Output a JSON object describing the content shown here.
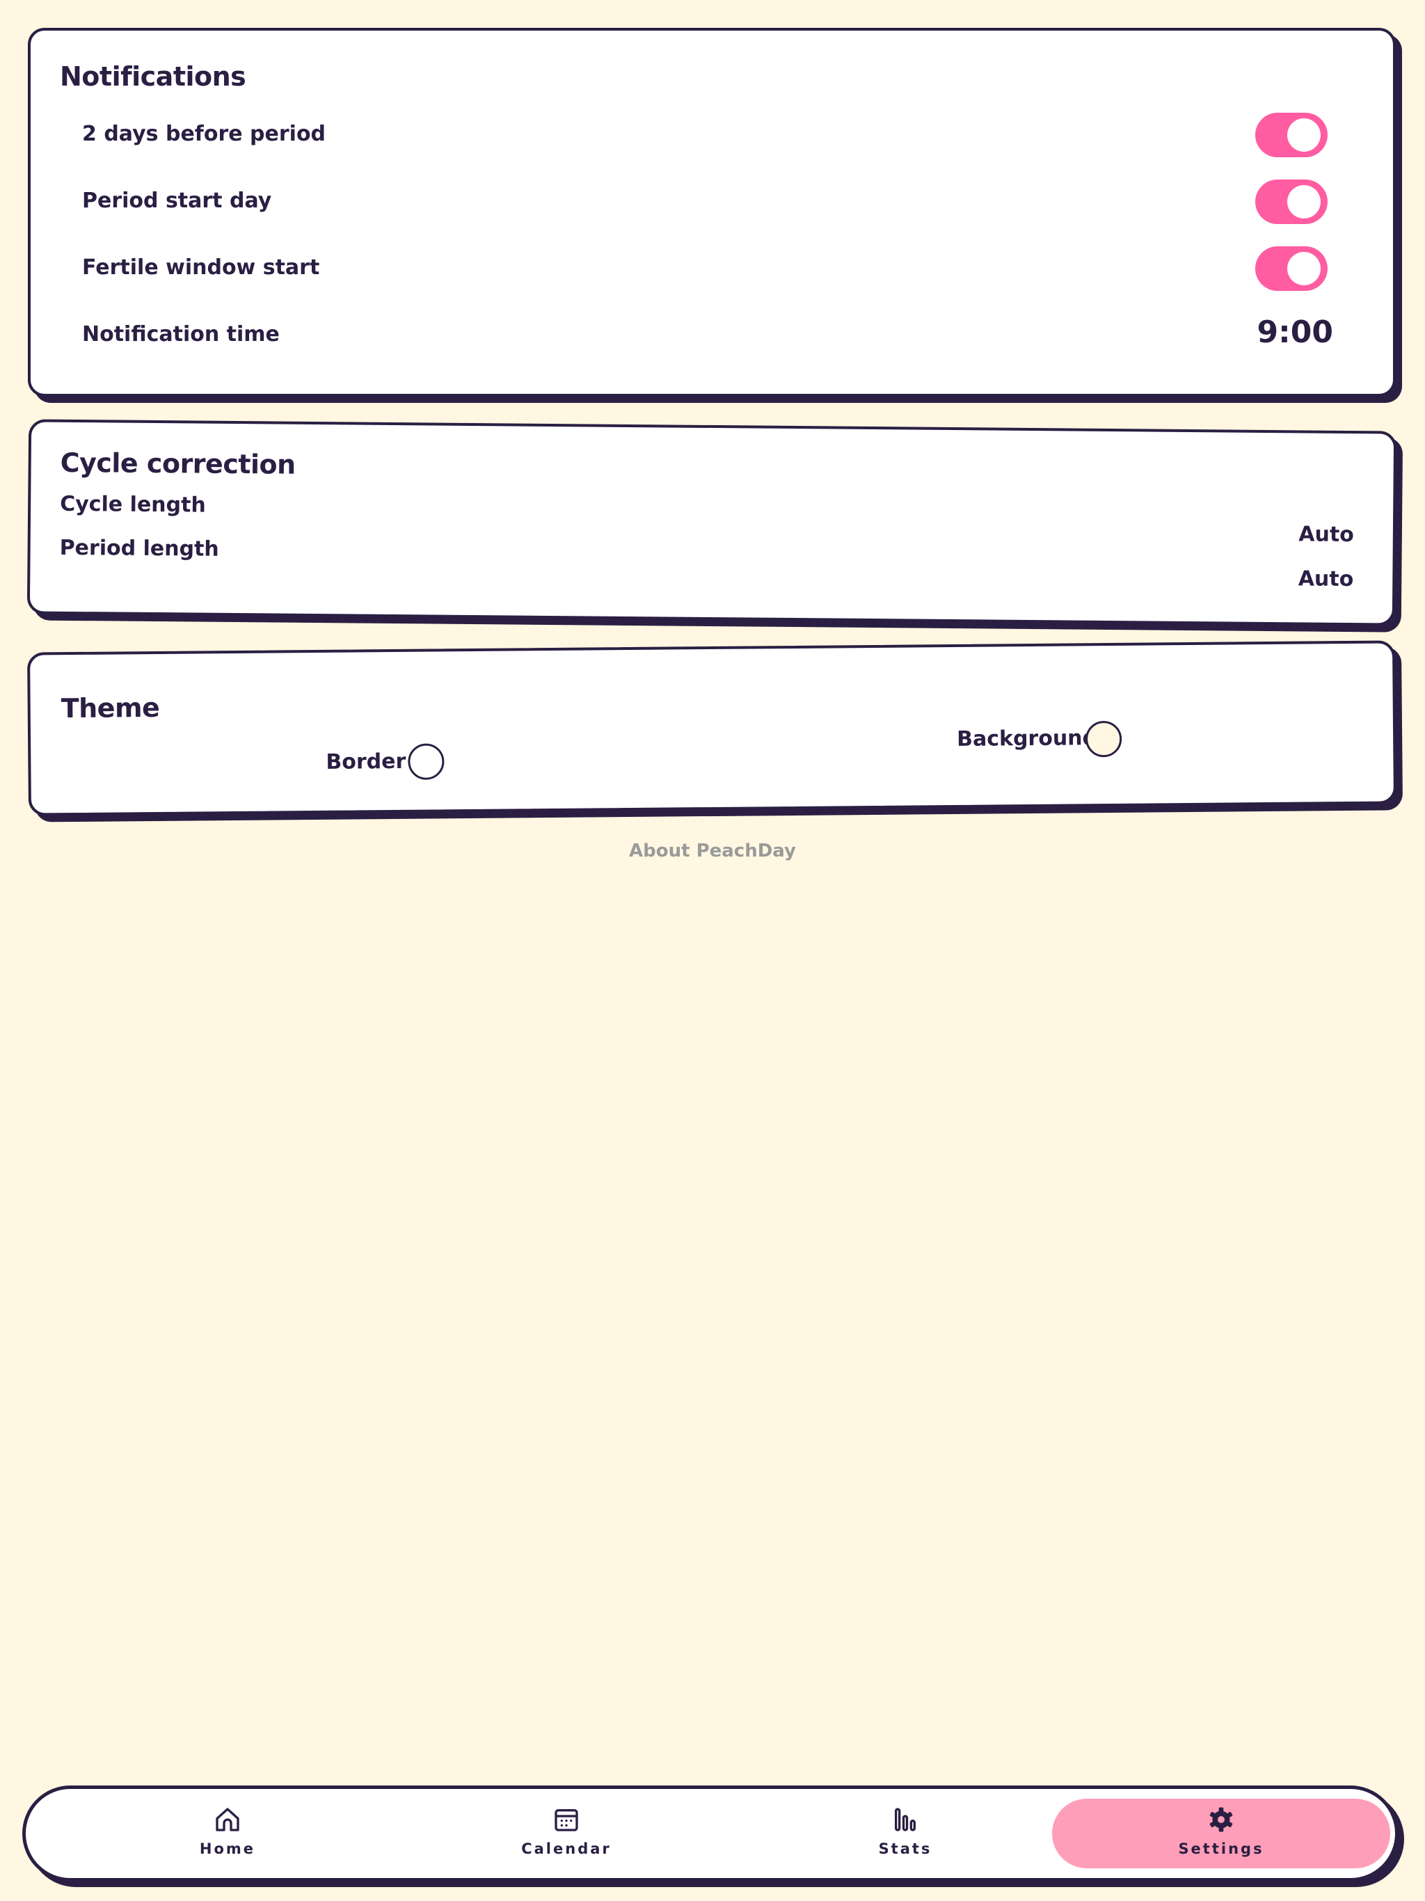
{
  "notifications": {
    "title": "Notifications",
    "rows": [
      {
        "label": "2 days before period",
        "enabled": true
      },
      {
        "label": "Period start day",
        "enabled": true
      },
      {
        "label": "Fertile window start",
        "enabled": true
      }
    ],
    "time_label": "Notification time",
    "time_value": "9:00"
  },
  "cycle_correction": {
    "title": "Cycle correction",
    "cycle_length_label": "Cycle length",
    "cycle_length_value": "Auto",
    "period_length_label": "Period length",
    "period_length_value": "Auto"
  },
  "theme": {
    "title": "Theme",
    "border_label": "Border",
    "border_color": "#FFFFFF",
    "background_label": "Background",
    "background_color": "#FFF7E1"
  },
  "about_link": "About PeachDay",
  "tabbar": {
    "items": [
      {
        "label": "Home",
        "icon": "home-icon",
        "active": false
      },
      {
        "label": "Calendar",
        "icon": "calendar-icon",
        "active": false
      },
      {
        "label": "Stats",
        "icon": "stats-icon",
        "active": false
      },
      {
        "label": "Settings",
        "icon": "gear-icon",
        "active": true
      }
    ]
  },
  "colors": {
    "background": "#FFF7E1",
    "ink": "#2A1F43",
    "toggle_on": "#FF5CA1",
    "active_tab": "#FF9EB8",
    "muted_text": "#9A9A9A"
  }
}
